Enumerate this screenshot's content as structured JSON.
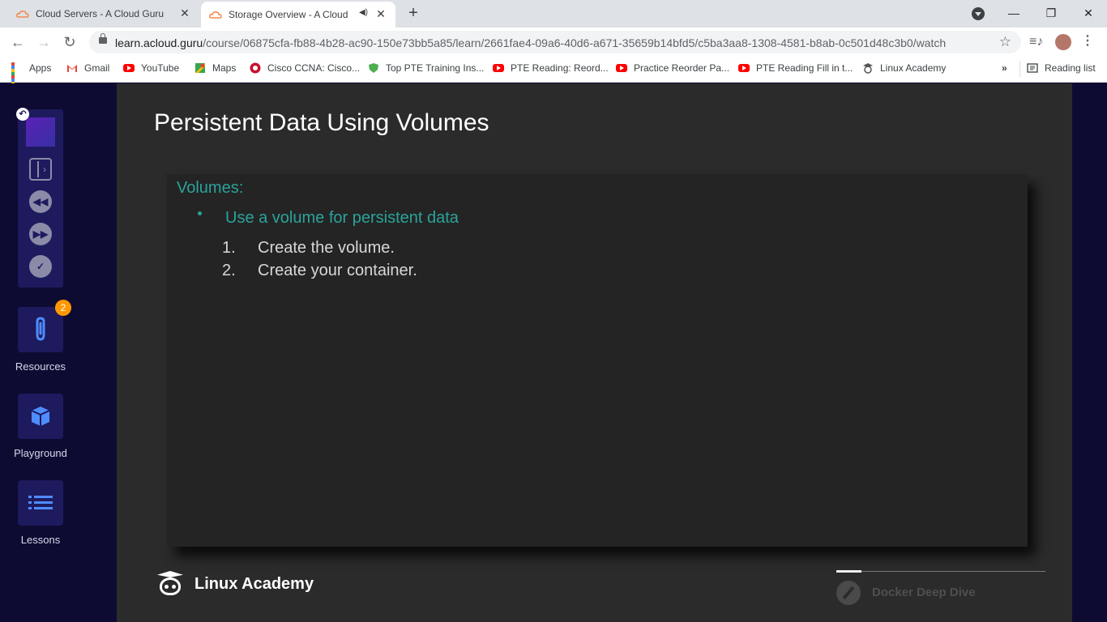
{
  "browser": {
    "tabs": [
      {
        "title": "Cloud Servers - A Cloud Guru",
        "active": false
      },
      {
        "title": "Storage Overview - A Cloud Guru",
        "active": true
      }
    ],
    "url_host": "learn.acloud.guru",
    "url_path": "/course/06875cfa-fb88-4b28-ac90-150e73bb5a85/learn/2661fae4-09a6-40d6-a671-35659b14bfd5/c5ba3aa8-1308-4581-b8ab-0c501d48c3b0/watch",
    "bookmarks": [
      {
        "label": "Apps",
        "icon": "apps-grid-icon"
      },
      {
        "label": "Gmail",
        "icon": "gmail-icon"
      },
      {
        "label": "YouTube",
        "icon": "youtube-icon"
      },
      {
        "label": "Maps",
        "icon": "maps-icon"
      },
      {
        "label": "Cisco CCNA: Cisco...",
        "icon": "cisco-icon"
      },
      {
        "label": "Top PTE Training Ins...",
        "icon": "pte-icon"
      },
      {
        "label": "PTE Reading: Reord...",
        "icon": "youtube-icon"
      },
      {
        "label": "Practice Reorder Pa...",
        "icon": "youtube-icon"
      },
      {
        "label": "PTE Reading Fill in t...",
        "icon": "youtube-icon"
      },
      {
        "label": "Linux Academy",
        "icon": "linux-academy-icon"
      }
    ],
    "more_bookmarks": "»",
    "reading_list": "Reading list"
  },
  "sidebar": {
    "resources_label": "Resources",
    "resources_badge": "2",
    "playground_label": "Playground",
    "lessons_label": "Lessons"
  },
  "slide": {
    "title": "Persistent Data Using Volumes",
    "heading": "Volumes:",
    "bullet": "Use a volume for persistent data",
    "steps": [
      {
        "num": "1.",
        "text": "Create the volume."
      },
      {
        "num": "2.",
        "text": "Create your container."
      }
    ],
    "brand": "Linux Academy",
    "course": "Docker Deep Dive",
    "course_progress": 0.12
  },
  "colors": {
    "accent_teal": "#2aa39b",
    "sidebar_bg": "#0e0b33",
    "button_bg": "#1e1a5e",
    "badge": "#ff9800"
  }
}
